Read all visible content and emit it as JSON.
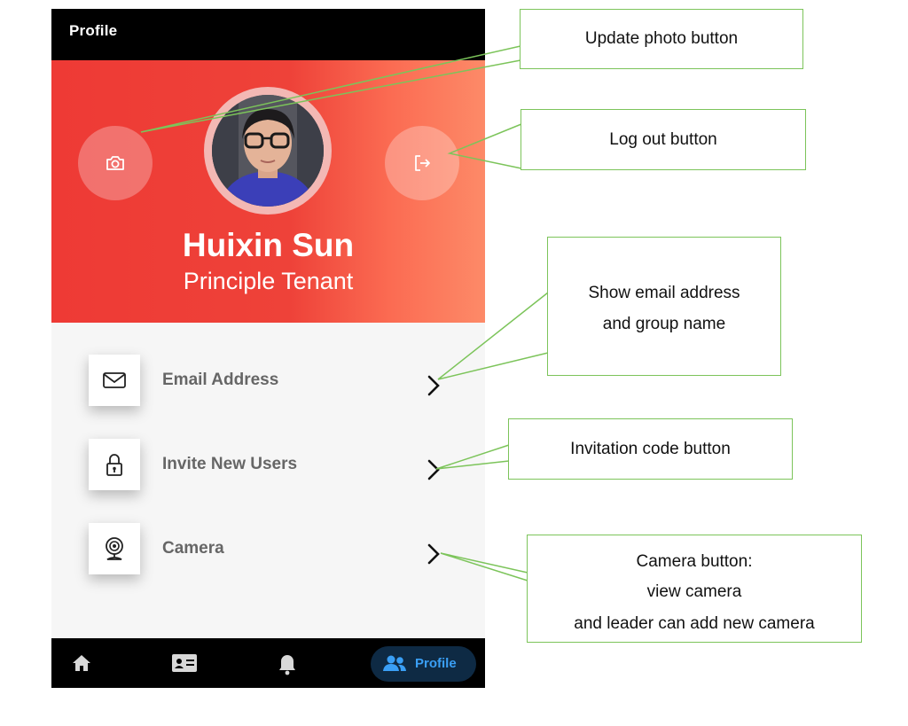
{
  "app": {
    "title": "Profile"
  },
  "profile": {
    "name": "Huixin Sun",
    "role": "Principle Tenant",
    "update_photo_icon": "camera-icon",
    "logout_icon": "logout-icon"
  },
  "menu": [
    {
      "label": "Email Address",
      "icon": "mail-icon"
    },
    {
      "label": "Invite New Users",
      "icon": "lock-icon"
    },
    {
      "label": "Camera",
      "icon": "webcam-icon"
    }
  ],
  "nav": {
    "items": [
      {
        "icon": "home-icon"
      },
      {
        "icon": "contact-card-icon"
      },
      {
        "icon": "bell-icon"
      },
      {
        "icon": "people-icon",
        "label": "Profile",
        "active": true
      }
    ],
    "active_color": "#3a9ff5"
  },
  "annotations": {
    "update_photo": "Update photo button",
    "logout": "Log out button",
    "email_line1": "Show email address",
    "email_line2": "and group name",
    "invite": "Invitation code button",
    "camera_line1": "Camera button:",
    "camera_line2": "view camera",
    "camera_line3": "and leader can add new camera"
  },
  "colors": {
    "header_start": "#ee3a35",
    "header_end": "#fd8a68",
    "callout_border": "#7cc45a"
  }
}
